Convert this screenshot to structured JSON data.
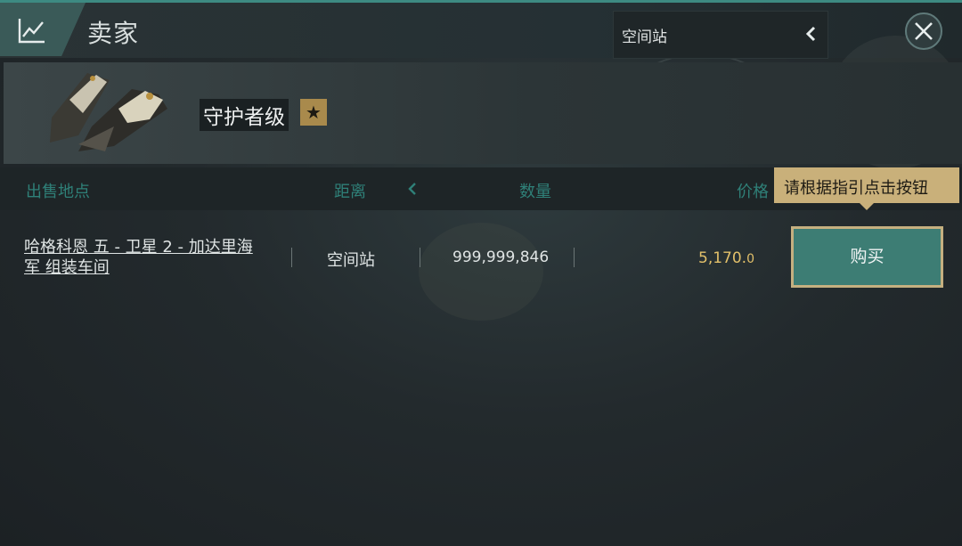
{
  "header": {
    "title": "卖家",
    "chart_icon": "line-chart-icon",
    "filter_label": "空间站",
    "filter_chevron_icon": "chevron-left-icon",
    "close_icon": "close-icon"
  },
  "item": {
    "name": "守护者级",
    "badge_icon": "star-icon",
    "badge_glyph": "★"
  },
  "columns": {
    "location": "出售地点",
    "distance": "距离",
    "quantity": "数量",
    "price": "价格"
  },
  "tooltip": "请根据指引点击按钮",
  "rows": [
    {
      "location": "哈格科恩 五 - 卫星 2 - 加达里海军 组装车间",
      "distance": "空间站",
      "quantity": "999,999,846",
      "price_main": "5,170.",
      "price_decimal": "0",
      "buy_label": "购买"
    }
  ],
  "colors": {
    "accent": "#3d7d74",
    "gold": "#c9b07a",
    "price": "#e2c06a",
    "header_text": "#2f8078"
  }
}
